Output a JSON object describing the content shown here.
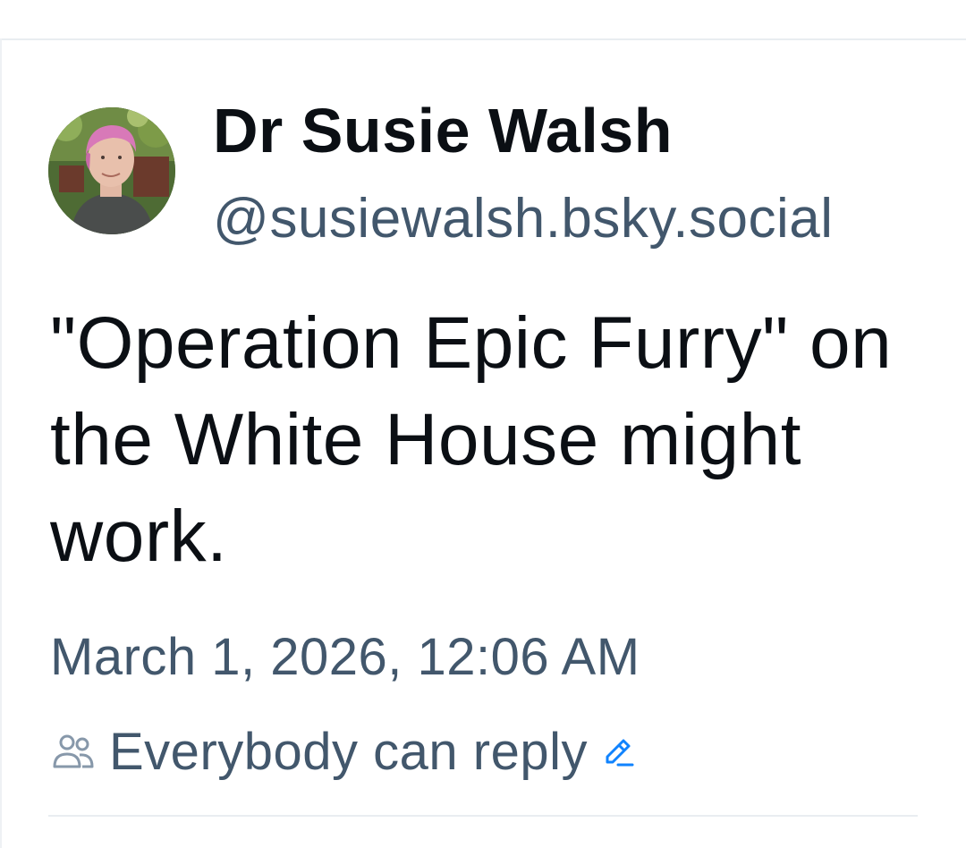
{
  "post": {
    "author": {
      "display_name": "Dr Susie Walsh",
      "handle": "@susiewalsh.bsky.social"
    },
    "text": "\"Operation Epic Furry\" on the White House might work.",
    "timestamp": "March 1, 2026, 12:06 AM",
    "reply_settings": {
      "label": "Everybody can reply",
      "icon": "people-icon",
      "edit_icon": "pencil-icon"
    }
  },
  "colors": {
    "text_primary": "#0b0f14",
    "text_secondary": "#42576c",
    "accent": "#1083fe",
    "divider": "#e9edf1"
  }
}
